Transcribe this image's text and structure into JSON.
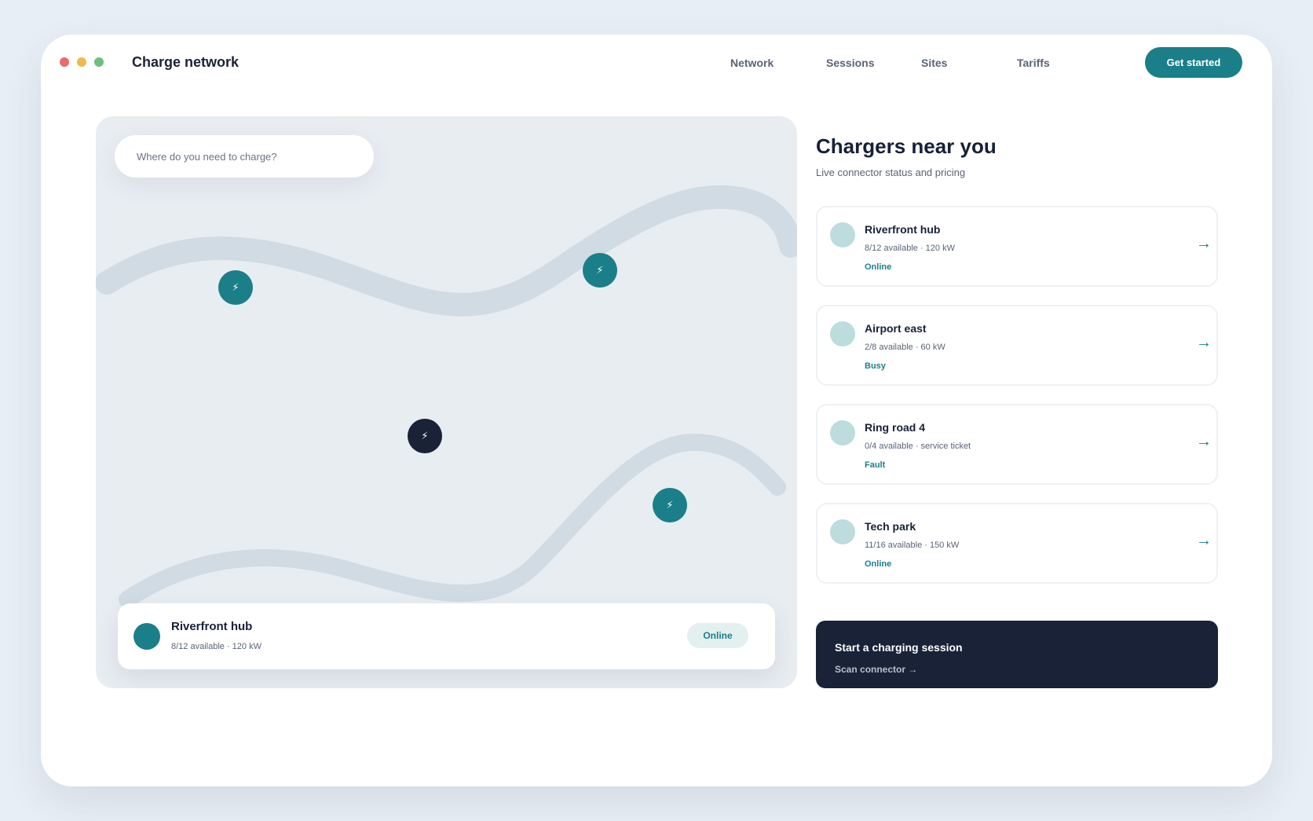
{
  "window": {
    "controls": [
      {
        "name": "close",
        "color": "#ec6a67"
      },
      {
        "name": "minimize",
        "color": "#f0b84e"
      },
      {
        "name": "maximize",
        "color": "#6cc07b"
      }
    ]
  },
  "header": {
    "brand": "Charge network",
    "nav": [
      "Network",
      "Sessions",
      "Sites",
      "Tariffs"
    ],
    "cta": "Get started"
  },
  "map": {
    "search_placeholder": "Where do you need to charge?",
    "pins": [
      {
        "icon": "bolt-icon",
        "state": "available"
      },
      {
        "icon": "bolt-icon",
        "state": "available"
      },
      {
        "icon": "bolt-icon",
        "state": "selected"
      },
      {
        "icon": "bolt-icon",
        "state": "available"
      }
    ],
    "pin_glyph": "⚡",
    "selected": {
      "title": "Riverfront hub",
      "meta": "8/12 available · 120 kW",
      "status": "Online"
    }
  },
  "panel": {
    "title": "Chargers near you",
    "subtitle": "Live connector status and pricing",
    "chargers": [
      {
        "name": "Riverfront hub",
        "meta": "8/12 available · 120 kW",
        "status": "Online"
      },
      {
        "name": "Airport east",
        "meta": "2/8 available · 60 kW",
        "status": "Busy"
      },
      {
        "name": "Ring road 4",
        "meta": "0/4 available · service ticket",
        "status": "Fault"
      },
      {
        "name": "Tech park",
        "meta": "11/16 available · 150 kW",
        "status": "Online"
      }
    ],
    "arrow": "→"
  },
  "session": {
    "title": "Start a charging session",
    "link": "Scan connector →"
  },
  "colors": {
    "accent": "#1a7f89",
    "dark": "#1a2238",
    "map_bg": "#e8edf2",
    "road": "#d1dbe3"
  }
}
